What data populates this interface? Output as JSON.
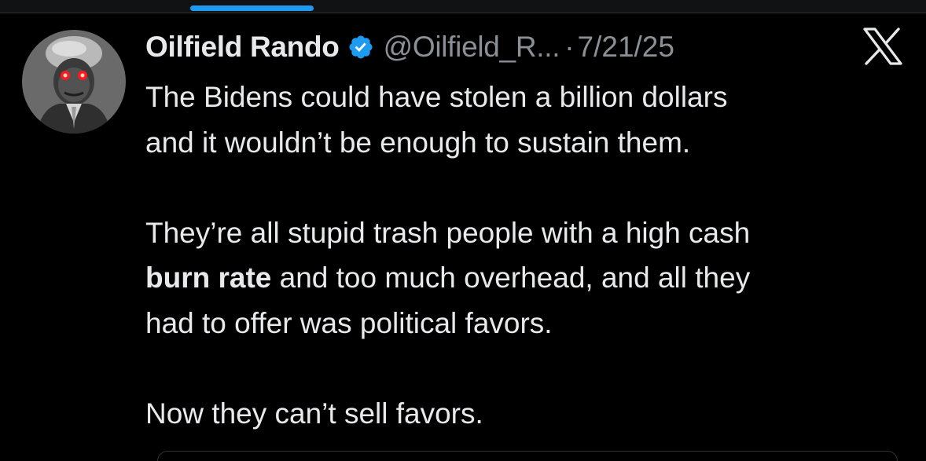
{
  "post": {
    "display_name": "Oilfield Rando",
    "handle": "@Oilfield_R...",
    "separator": "·",
    "date": "7/21/25",
    "paragraphs": [
      {
        "line1": "The Bidens could have stolen a billion dollars",
        "line2": "and it wouldn’t be enough to sustain them."
      },
      {
        "line1": "They’re all stupid trash people with a high cash",
        "line2_bold": "burn rate",
        "line2_rest": " and too much overhead, and all they",
        "line3": "had to offer was political favors."
      },
      {
        "line1": "Now they can’t sell favors."
      }
    ]
  },
  "icons": {
    "verified": "verified-badge-icon",
    "brand": "x-logo-icon"
  },
  "colors": {
    "background": "#000000",
    "text": "#e7e9ea",
    "secondary_text": "#8b9096",
    "accent": "#1d9bf0"
  }
}
